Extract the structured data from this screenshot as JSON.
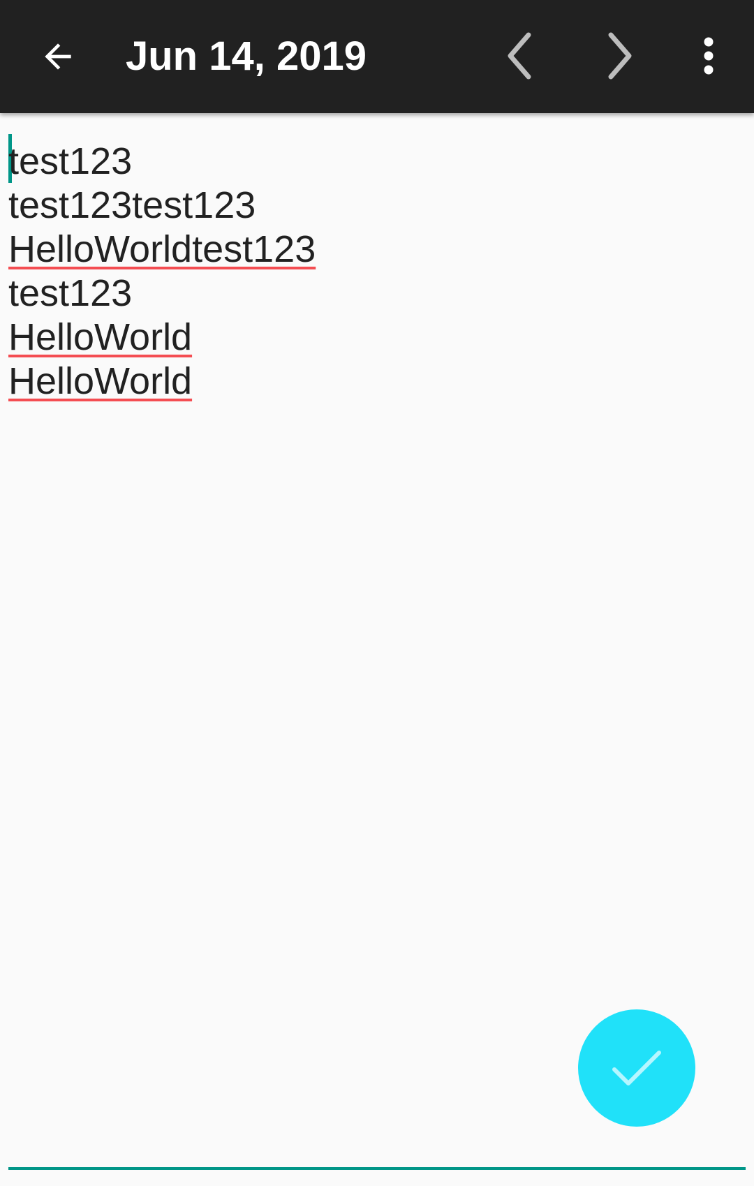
{
  "toolbar": {
    "title": "Jun 14, 2019",
    "icons": {
      "back": "arrow-left-icon",
      "previous": "chevron-left-icon",
      "next": "chevron-right-icon",
      "more": "more-vertical-icon"
    }
  },
  "editor": {
    "lines": [
      {
        "text": "test123",
        "misspelled": false
      },
      {
        "text": "test123test123",
        "misspelled": false
      },
      {
        "text": "HelloWorldtest123",
        "misspelled": true
      },
      {
        "text": "test123",
        "misspelled": false
      },
      {
        "text": "HelloWorld",
        "misspelled": true
      },
      {
        "text": "HelloWorld",
        "misspelled": true
      }
    ]
  },
  "fab": {
    "icon": "check-icon"
  },
  "colors": {
    "toolbar_bg": "#212121",
    "background": "#fafafa",
    "accent": "#009688",
    "fab": "#20e1f9",
    "spellcheck": "#f44d52"
  }
}
